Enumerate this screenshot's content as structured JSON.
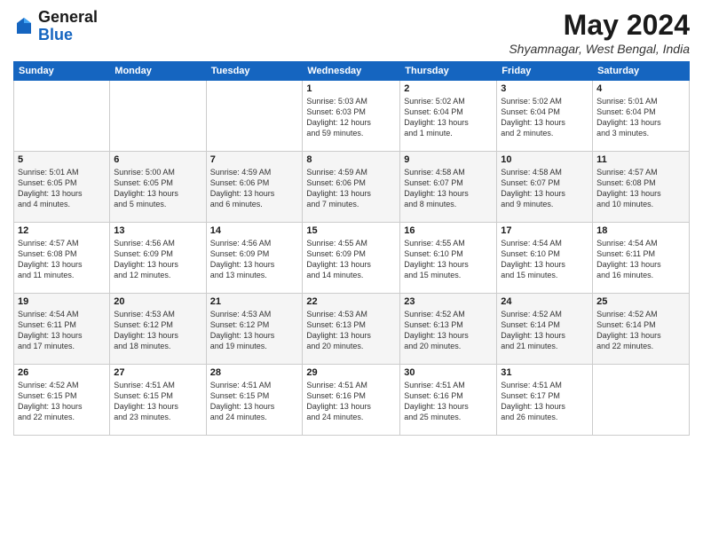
{
  "logo": {
    "general": "General",
    "blue": "Blue"
  },
  "title": "May 2024",
  "location": "Shyamnagar, West Bengal, India",
  "weekdays": [
    "Sunday",
    "Monday",
    "Tuesday",
    "Wednesday",
    "Thursday",
    "Friday",
    "Saturday"
  ],
  "weeks": [
    [
      {
        "day": "",
        "info": ""
      },
      {
        "day": "",
        "info": ""
      },
      {
        "day": "",
        "info": ""
      },
      {
        "day": "1",
        "info": "Sunrise: 5:03 AM\nSunset: 6:03 PM\nDaylight: 12 hours\nand 59 minutes."
      },
      {
        "day": "2",
        "info": "Sunrise: 5:02 AM\nSunset: 6:04 PM\nDaylight: 13 hours\nand 1 minute."
      },
      {
        "day": "3",
        "info": "Sunrise: 5:02 AM\nSunset: 6:04 PM\nDaylight: 13 hours\nand 2 minutes."
      },
      {
        "day": "4",
        "info": "Sunrise: 5:01 AM\nSunset: 6:04 PM\nDaylight: 13 hours\nand 3 minutes."
      }
    ],
    [
      {
        "day": "5",
        "info": "Sunrise: 5:01 AM\nSunset: 6:05 PM\nDaylight: 13 hours\nand 4 minutes."
      },
      {
        "day": "6",
        "info": "Sunrise: 5:00 AM\nSunset: 6:05 PM\nDaylight: 13 hours\nand 5 minutes."
      },
      {
        "day": "7",
        "info": "Sunrise: 4:59 AM\nSunset: 6:06 PM\nDaylight: 13 hours\nand 6 minutes."
      },
      {
        "day": "8",
        "info": "Sunrise: 4:59 AM\nSunset: 6:06 PM\nDaylight: 13 hours\nand 7 minutes."
      },
      {
        "day": "9",
        "info": "Sunrise: 4:58 AM\nSunset: 6:07 PM\nDaylight: 13 hours\nand 8 minutes."
      },
      {
        "day": "10",
        "info": "Sunrise: 4:58 AM\nSunset: 6:07 PM\nDaylight: 13 hours\nand 9 minutes."
      },
      {
        "day": "11",
        "info": "Sunrise: 4:57 AM\nSunset: 6:08 PM\nDaylight: 13 hours\nand 10 minutes."
      }
    ],
    [
      {
        "day": "12",
        "info": "Sunrise: 4:57 AM\nSunset: 6:08 PM\nDaylight: 13 hours\nand 11 minutes."
      },
      {
        "day": "13",
        "info": "Sunrise: 4:56 AM\nSunset: 6:09 PM\nDaylight: 13 hours\nand 12 minutes."
      },
      {
        "day": "14",
        "info": "Sunrise: 4:56 AM\nSunset: 6:09 PM\nDaylight: 13 hours\nand 13 minutes."
      },
      {
        "day": "15",
        "info": "Sunrise: 4:55 AM\nSunset: 6:09 PM\nDaylight: 13 hours\nand 14 minutes."
      },
      {
        "day": "16",
        "info": "Sunrise: 4:55 AM\nSunset: 6:10 PM\nDaylight: 13 hours\nand 15 minutes."
      },
      {
        "day": "17",
        "info": "Sunrise: 4:54 AM\nSunset: 6:10 PM\nDaylight: 13 hours\nand 15 minutes."
      },
      {
        "day": "18",
        "info": "Sunrise: 4:54 AM\nSunset: 6:11 PM\nDaylight: 13 hours\nand 16 minutes."
      }
    ],
    [
      {
        "day": "19",
        "info": "Sunrise: 4:54 AM\nSunset: 6:11 PM\nDaylight: 13 hours\nand 17 minutes."
      },
      {
        "day": "20",
        "info": "Sunrise: 4:53 AM\nSunset: 6:12 PM\nDaylight: 13 hours\nand 18 minutes."
      },
      {
        "day": "21",
        "info": "Sunrise: 4:53 AM\nSunset: 6:12 PM\nDaylight: 13 hours\nand 19 minutes."
      },
      {
        "day": "22",
        "info": "Sunrise: 4:53 AM\nSunset: 6:13 PM\nDaylight: 13 hours\nand 20 minutes."
      },
      {
        "day": "23",
        "info": "Sunrise: 4:52 AM\nSunset: 6:13 PM\nDaylight: 13 hours\nand 20 minutes."
      },
      {
        "day": "24",
        "info": "Sunrise: 4:52 AM\nSunset: 6:14 PM\nDaylight: 13 hours\nand 21 minutes."
      },
      {
        "day": "25",
        "info": "Sunrise: 4:52 AM\nSunset: 6:14 PM\nDaylight: 13 hours\nand 22 minutes."
      }
    ],
    [
      {
        "day": "26",
        "info": "Sunrise: 4:52 AM\nSunset: 6:15 PM\nDaylight: 13 hours\nand 22 minutes."
      },
      {
        "day": "27",
        "info": "Sunrise: 4:51 AM\nSunset: 6:15 PM\nDaylight: 13 hours\nand 23 minutes."
      },
      {
        "day": "28",
        "info": "Sunrise: 4:51 AM\nSunset: 6:15 PM\nDaylight: 13 hours\nand 24 minutes."
      },
      {
        "day": "29",
        "info": "Sunrise: 4:51 AM\nSunset: 6:16 PM\nDaylight: 13 hours\nand 24 minutes."
      },
      {
        "day": "30",
        "info": "Sunrise: 4:51 AM\nSunset: 6:16 PM\nDaylight: 13 hours\nand 25 minutes."
      },
      {
        "day": "31",
        "info": "Sunrise: 4:51 AM\nSunset: 6:17 PM\nDaylight: 13 hours\nand 26 minutes."
      },
      {
        "day": "",
        "info": ""
      }
    ]
  ]
}
